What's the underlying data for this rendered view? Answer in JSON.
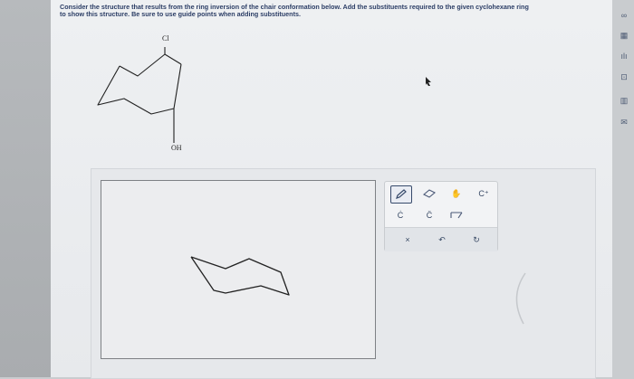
{
  "question": {
    "line1": "Consider the structure that results from the ring inversion of the chair conformation below. Add the substituents required to the given cyclohexane ring",
    "line2": "to show this structure. Be sure to use guide points when adding substituents."
  },
  "molecule": {
    "top_substituent": "Cl",
    "bottom_substituent": "OH"
  },
  "palette": {
    "tools": [
      {
        "name": "pencil-tool",
        "glyph": "✎"
      },
      {
        "name": "eraser-tool",
        "glyph": "⌫"
      },
      {
        "name": "hand-tool",
        "glyph": "✋"
      },
      {
        "name": "cation-tool",
        "glyph": "C⁺"
      },
      {
        "name": "radical-tool",
        "glyph": "Ċ"
      },
      {
        "name": "lone-pair-carbon-tool",
        "glyph": "C̈"
      },
      {
        "name": "wedge-tool",
        "glyph": "⌒"
      }
    ],
    "bottom": {
      "clear": "×",
      "undo": "↶",
      "redo": "↻"
    }
  },
  "sidebar": {
    "icons": [
      "link-icon",
      "calculator-icon",
      "chart-icon",
      "image-icon",
      "table-icon",
      "mail-icon"
    ],
    "glyphs": [
      "∞",
      "▦",
      "ılı",
      "⊡",
      "▥",
      "✉"
    ]
  }
}
